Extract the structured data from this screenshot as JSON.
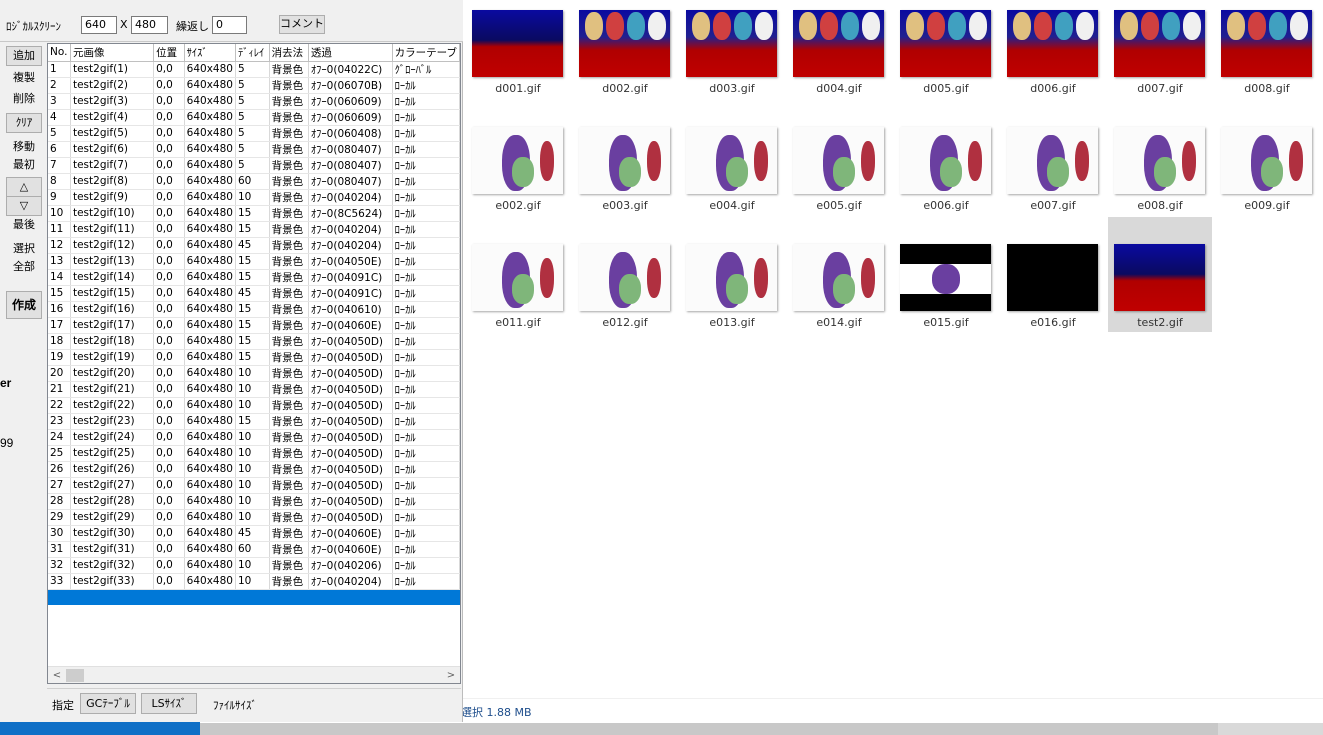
{
  "tool": {
    "logical_screen_label": "ﾛｼﾞｶﾙｽｸﾘｰﾝ",
    "width_value": "640",
    "times_label": "X",
    "height_value": "480",
    "repeat_label": "繰返し",
    "repeat_value": "0",
    "comment_button": "コメント",
    "side_buttons": {
      "add": "追加",
      "duplicate": "複製",
      "delete": "削除",
      "clear": "ｸﾘｱ",
      "move": "移動",
      "first": "最初",
      "up": "△",
      "down": "▽",
      "last": "最後",
      "select": "選択",
      "all": "全部",
      "create": "作成"
    },
    "columns": [
      "No.",
      "元画像",
      "位置",
      "ｻｲｽﾞ",
      "ﾃﾞｨﾚｲ",
      "消去法",
      "透過",
      "カラーテーブ"
    ],
    "rows": [
      [
        "1",
        "test2gif(1)",
        "0,0",
        "640x480",
        "5",
        "背景色",
        "ｵﾌｰ0(04022C)",
        "ｸﾞﾛｰﾊﾞﾙ"
      ],
      [
        "2",
        "test2gif(2)",
        "0,0",
        "640x480",
        "5",
        "背景色",
        "ｵﾌｰ0(06070B)",
        "ﾛｰｶﾙ"
      ],
      [
        "3",
        "test2gif(3)",
        "0,0",
        "640x480",
        "5",
        "背景色",
        "ｵﾌｰ0(060609)",
        "ﾛｰｶﾙ"
      ],
      [
        "4",
        "test2gif(4)",
        "0,0",
        "640x480",
        "5",
        "背景色",
        "ｵﾌｰ0(060609)",
        "ﾛｰｶﾙ"
      ],
      [
        "5",
        "test2gif(5)",
        "0,0",
        "640x480",
        "5",
        "背景色",
        "ｵﾌｰ0(060408)",
        "ﾛｰｶﾙ"
      ],
      [
        "6",
        "test2gif(6)",
        "0,0",
        "640x480",
        "5",
        "背景色",
        "ｵﾌｰ0(080407)",
        "ﾛｰｶﾙ"
      ],
      [
        "7",
        "test2gif(7)",
        "0,0",
        "640x480",
        "5",
        "背景色",
        "ｵﾌｰ0(080407)",
        "ﾛｰｶﾙ"
      ],
      [
        "8",
        "test2gif(8)",
        "0,0",
        "640x480",
        "60",
        "背景色",
        "ｵﾌｰ0(080407)",
        "ﾛｰｶﾙ"
      ],
      [
        "9",
        "test2gif(9)",
        "0,0",
        "640x480",
        "10",
        "背景色",
        "ｵﾌｰ0(040204)",
        "ﾛｰｶﾙ"
      ],
      [
        "10",
        "test2gif(10)",
        "0,0",
        "640x480",
        "15",
        "背景色",
        "ｵﾌｰ0(8C5624)",
        "ﾛｰｶﾙ"
      ],
      [
        "11",
        "test2gif(11)",
        "0,0",
        "640x480",
        "15",
        "背景色",
        "ｵﾌｰ0(040204)",
        "ﾛｰｶﾙ"
      ],
      [
        "12",
        "test2gif(12)",
        "0,0",
        "640x480",
        "45",
        "背景色",
        "ｵﾌｰ0(040204)",
        "ﾛｰｶﾙ"
      ],
      [
        "13",
        "test2gif(13)",
        "0,0",
        "640x480",
        "15",
        "背景色",
        "ｵﾌｰ0(04050E)",
        "ﾛｰｶﾙ"
      ],
      [
        "14",
        "test2gif(14)",
        "0,0",
        "640x480",
        "15",
        "背景色",
        "ｵﾌｰ0(04091C)",
        "ﾛｰｶﾙ"
      ],
      [
        "15",
        "test2gif(15)",
        "0,0",
        "640x480",
        "45",
        "背景色",
        "ｵﾌｰ0(04091C)",
        "ﾛｰｶﾙ"
      ],
      [
        "16",
        "test2gif(16)",
        "0,0",
        "640x480",
        "15",
        "背景色",
        "ｵﾌｰ0(040610)",
        "ﾛｰｶﾙ"
      ],
      [
        "17",
        "test2gif(17)",
        "0,0",
        "640x480",
        "15",
        "背景色",
        "ｵﾌｰ0(04060E)",
        "ﾛｰｶﾙ"
      ],
      [
        "18",
        "test2gif(18)",
        "0,0",
        "640x480",
        "15",
        "背景色",
        "ｵﾌｰ0(04050D)",
        "ﾛｰｶﾙ"
      ],
      [
        "19",
        "test2gif(19)",
        "0,0",
        "640x480",
        "15",
        "背景色",
        "ｵﾌｰ0(04050D)",
        "ﾛｰｶﾙ"
      ],
      [
        "20",
        "test2gif(20)",
        "0,0",
        "640x480",
        "10",
        "背景色",
        "ｵﾌｰ0(04050D)",
        "ﾛｰｶﾙ"
      ],
      [
        "21",
        "test2gif(21)",
        "0,0",
        "640x480",
        "10",
        "背景色",
        "ｵﾌｰ0(04050D)",
        "ﾛｰｶﾙ"
      ],
      [
        "22",
        "test2gif(22)",
        "0,0",
        "640x480",
        "10",
        "背景色",
        "ｵﾌｰ0(04050D)",
        "ﾛｰｶﾙ"
      ],
      [
        "23",
        "test2gif(23)",
        "0,0",
        "640x480",
        "15",
        "背景色",
        "ｵﾌｰ0(04050D)",
        "ﾛｰｶﾙ"
      ],
      [
        "24",
        "test2gif(24)",
        "0,0",
        "640x480",
        "10",
        "背景色",
        "ｵﾌｰ0(04050D)",
        "ﾛｰｶﾙ"
      ],
      [
        "25",
        "test2gif(25)",
        "0,0",
        "640x480",
        "10",
        "背景色",
        "ｵﾌｰ0(04050D)",
        "ﾛｰｶﾙ"
      ],
      [
        "26",
        "test2gif(26)",
        "0,0",
        "640x480",
        "10",
        "背景色",
        "ｵﾌｰ0(04050D)",
        "ﾛｰｶﾙ"
      ],
      [
        "27",
        "test2gif(27)",
        "0,0",
        "640x480",
        "10",
        "背景色",
        "ｵﾌｰ0(04050D)",
        "ﾛｰｶﾙ"
      ],
      [
        "28",
        "test2gif(28)",
        "0,0",
        "640x480",
        "10",
        "背景色",
        "ｵﾌｰ0(04050D)",
        "ﾛｰｶﾙ"
      ],
      [
        "29",
        "test2gif(29)",
        "0,0",
        "640x480",
        "10",
        "背景色",
        "ｵﾌｰ0(04050D)",
        "ﾛｰｶﾙ"
      ],
      [
        "30",
        "test2gif(30)",
        "0,0",
        "640x480",
        "45",
        "背景色",
        "ｵﾌｰ0(04060E)",
        "ﾛｰｶﾙ"
      ],
      [
        "31",
        "test2gif(31)",
        "0,0",
        "640x480",
        "60",
        "背景色",
        "ｵﾌｰ0(04060E)",
        "ﾛｰｶﾙ"
      ],
      [
        "32",
        "test2gif(32)",
        "0,0",
        "640x480",
        "10",
        "背景色",
        "ｵﾌｰ0(040206)",
        "ﾛｰｶﾙ"
      ],
      [
        "33",
        "test2gif(33)",
        "0,0",
        "640x480",
        "10",
        "背景色",
        "ｵﾌｰ0(040204)",
        "ﾛｰｶﾙ"
      ],
      [
        "",
        "",
        "",
        "",
        "",
        "",
        "",
        ""
      ]
    ],
    "bottom": {
      "specify_label": "指定",
      "gc_table_button": "GCﾃｰﾌﾞﾙ",
      "ls_size_button": "LSｻｲｽﾞ",
      "file_size_label": "ﾌｧｲﾙｻｲｽﾞ"
    }
  },
  "explorer": {
    "items": [
      {
        "name": "d001.gif",
        "style": "t-title"
      },
      {
        "name": "d002.gif",
        "style": "t-title-chars"
      },
      {
        "name": "d003.gif",
        "style": "t-title-chars"
      },
      {
        "name": "d004.gif",
        "style": "t-title-chars"
      },
      {
        "name": "d005.gif",
        "style": "t-title-chars"
      },
      {
        "name": "d006.gif",
        "style": "t-title-chars"
      },
      {
        "name": "d007.gif",
        "style": "t-title-chars"
      },
      {
        "name": "d008.gif",
        "style": "t-title-chars"
      },
      {
        "name": "e002.gif",
        "style": "t-white"
      },
      {
        "name": "e003.gif",
        "style": "t-white"
      },
      {
        "name": "e004.gif",
        "style": "t-white"
      },
      {
        "name": "e005.gif",
        "style": "t-white"
      },
      {
        "name": "e006.gif",
        "style": "t-white"
      },
      {
        "name": "e007.gif",
        "style": "t-white"
      },
      {
        "name": "e008.gif",
        "style": "t-white"
      },
      {
        "name": "e009.gif",
        "style": "t-white"
      },
      {
        "name": "e011.gif",
        "style": "t-white"
      },
      {
        "name": "e012.gif",
        "style": "t-white"
      },
      {
        "name": "e013.gif",
        "style": "t-white"
      },
      {
        "name": "e014.gif",
        "style": "t-white"
      },
      {
        "name": "e015.gif",
        "style": "t-band"
      },
      {
        "name": "e016.gif",
        "style": "t-black"
      },
      {
        "name": "test2.gif",
        "style": "t-title",
        "selected": true
      }
    ],
    "status_text": "選択  1.88 MB",
    "left_fragment_1": "er",
    "left_fragment_2": "99"
  }
}
